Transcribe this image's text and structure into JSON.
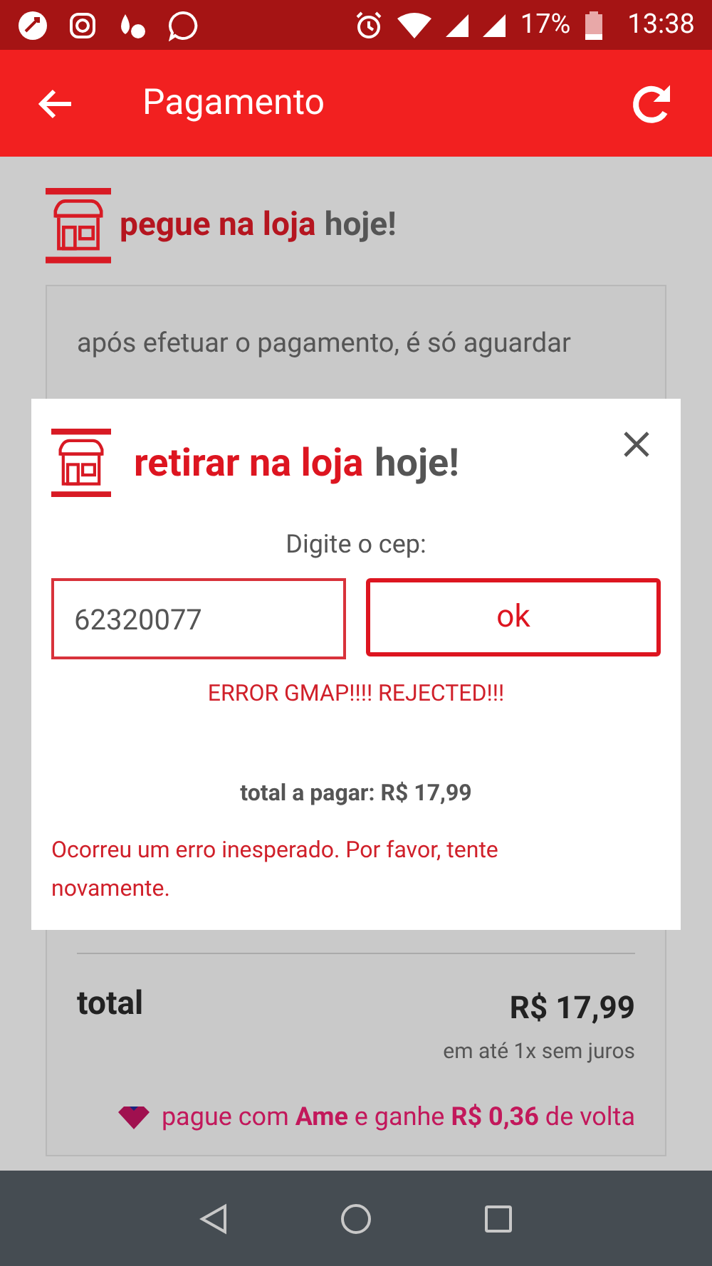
{
  "status_bar": {
    "battery": "17%",
    "time": "13:38"
  },
  "app_bar": {
    "title": "Pagamento"
  },
  "store_header": {
    "highlight": "pegue na loja",
    "rest": "hoje!"
  },
  "info_card": {
    "lines": [
      "após efetuar o pagamento, é só aguardar"
    ]
  },
  "summary": {
    "total_label": "total",
    "total_value": "R$ 17,99",
    "installments": "em até 1x sem juros",
    "cashback": "pague com **Ame** e ganhe **R$ 0,36** de volta"
  },
  "modal": {
    "title_highlight": "retirar na loja",
    "title_rest": "hoje!",
    "prompt": "Digite o cep:",
    "cep_value": "62320077",
    "ok_button": "ok",
    "gmap_error": "ERROR GMAP!!!! REJECTED!!!",
    "total_to_pay": "total a pagar: R$ 17,99",
    "error_message": "Ocorreu um erro inesperado. Por favor, tente novamente."
  }
}
